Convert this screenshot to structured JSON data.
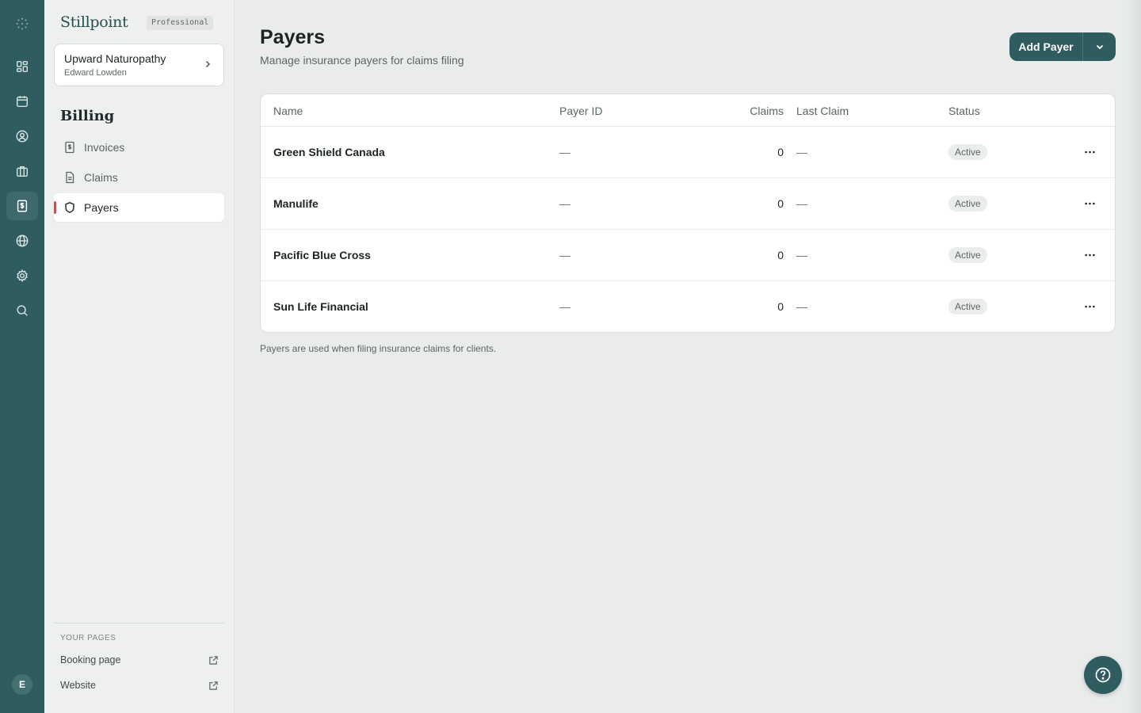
{
  "app": {
    "brand": "Stillpoint",
    "plan": "Professional"
  },
  "rail": {
    "items": [
      {
        "icon": "logo-dots-icon"
      },
      {
        "icon": "dashboard-icon"
      },
      {
        "icon": "calendar-icon"
      },
      {
        "icon": "client-icon"
      },
      {
        "icon": "briefcase-icon"
      },
      {
        "icon": "billing-icon",
        "active": true
      },
      {
        "icon": "globe-icon"
      },
      {
        "icon": "gear-icon"
      },
      {
        "icon": "search-icon"
      }
    ],
    "avatar_initial": "E"
  },
  "practice": {
    "name": "Upward Naturopathy",
    "owner": "Edward Lowden"
  },
  "sidebar": {
    "section_title": "Billing",
    "items": [
      {
        "label": "Invoices",
        "icon": "invoice-icon"
      },
      {
        "label": "Claims",
        "icon": "document-icon"
      },
      {
        "label": "Payers",
        "icon": "shield-icon",
        "active": true
      }
    ],
    "pages_label": "YOUR PAGES",
    "pages": [
      {
        "label": "Booking page",
        "icon": "external-link-icon"
      },
      {
        "label": "Website",
        "icon": "external-link-icon"
      }
    ]
  },
  "header": {
    "title": "Payers",
    "subtitle": "Manage insurance payers for claims filing",
    "add_button": "Add Payer"
  },
  "table": {
    "columns": [
      "Name",
      "Payer ID",
      "Claims",
      "Last Claim",
      "Status"
    ],
    "rows": [
      {
        "name": "Green Shield Canada",
        "payer_id": "—",
        "claims": "0",
        "last_claim": "—",
        "status": "Active"
      },
      {
        "name": "Manulife",
        "payer_id": "—",
        "claims": "0",
        "last_claim": "—",
        "status": "Active"
      },
      {
        "name": "Pacific Blue Cross",
        "payer_id": "—",
        "claims": "0",
        "last_claim": "—",
        "status": "Active"
      },
      {
        "name": "Sun Life Financial",
        "payer_id": "—",
        "claims": "0",
        "last_claim": "—",
        "status": "Active"
      }
    ]
  },
  "footnote": "Payers are used when filing insurance claims for clients.",
  "colors": {
    "primary": "#2f5c5e",
    "background": "#e9eceb",
    "indicator": "#b55a5a"
  }
}
